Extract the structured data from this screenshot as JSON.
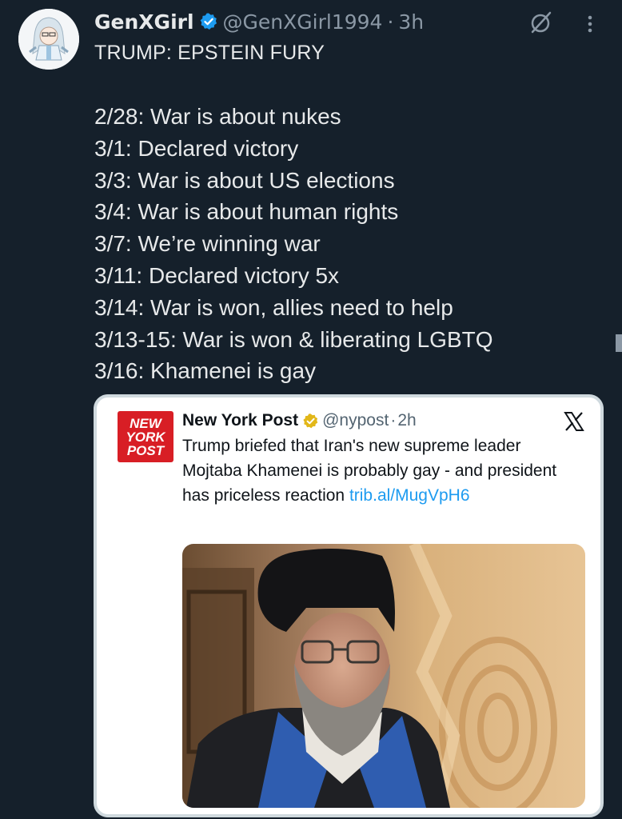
{
  "tweet": {
    "author_name": "GenXGirl",
    "handle": "@GenXGirl1994",
    "separator": "·",
    "time": "3h",
    "headline": "TRUMP: EPSTEIN FURY",
    "lines": [
      "2/28: War is about nukes",
      "3/1: Declared victory",
      "3/3: War is about US elections",
      "3/4: War is about human rights",
      "3/7: We’re winning war",
      "3/11: Declared victory 5x",
      "3/14: War is won, allies need to help",
      "3/13-15: War is won & liberating LGBTQ",
      "3/16: Khamenei is gay"
    ]
  },
  "quote": {
    "logo_lines": [
      "NEW",
      "YORK",
      "POST"
    ],
    "author_name": "New York Post",
    "handle": "@nypost",
    "separator": "·",
    "time": "2h",
    "text": "Trump briefed that Iran's new supreme leader Mojtaba Khamenei is probably gay - and president has priceless reaction ",
    "link": "trib.al/MugVpH6"
  },
  "icons": {
    "verified_blue": "verified-icon",
    "verified_gold": "verified-gold-icon",
    "grok": "grok-icon",
    "more": "more-icon",
    "x_logo": "x-logo-icon"
  },
  "colors": {
    "background": "#15202b",
    "text": "#e7e9ea",
    "muted": "#8b98a5",
    "link": "#1d9bf0",
    "verified_blue": "#1d9bf0",
    "verified_gold": "#e2b719",
    "nyp_red": "#d81e25"
  }
}
